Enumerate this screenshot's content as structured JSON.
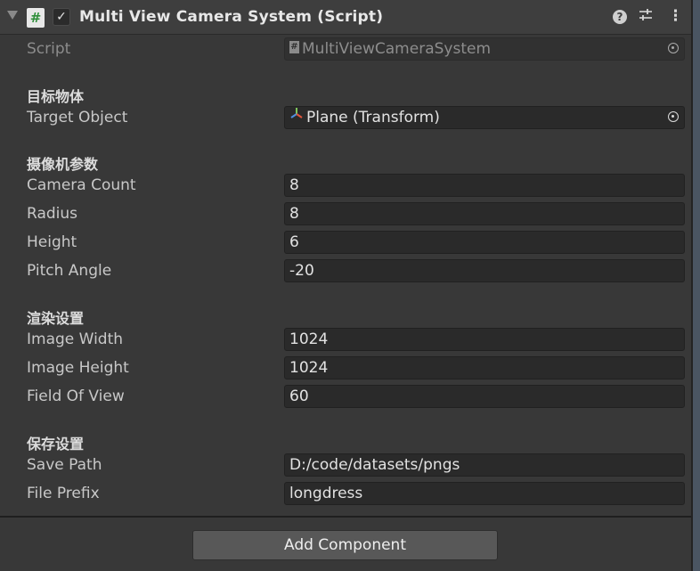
{
  "header": {
    "title": "Multi View Camera System (Script)",
    "enabled_check": "✓",
    "script_icon": "#",
    "icons": [
      "fold-arrow-icon",
      "script-hash-icon",
      "help-icon",
      "preset-sliders-icon",
      "kebab-menu-icon"
    ]
  },
  "script_row": {
    "label": "Script",
    "value": "MultiViewCameraSystem"
  },
  "sections": {
    "target": "目标物体",
    "camera": "摄像机参数",
    "render": "渲染设置",
    "save": "保存设置"
  },
  "fields": {
    "target_object": {
      "label": "Target Object",
      "value": "Plane (Transform)"
    },
    "camera_count": {
      "label": "Camera Count",
      "value": "8"
    },
    "radius": {
      "label": "Radius",
      "value": "8"
    },
    "height": {
      "label": "Height",
      "value": "6"
    },
    "pitch_angle": {
      "label": "Pitch Angle",
      "value": "-20"
    },
    "image_width": {
      "label": "Image Width",
      "value": "1024"
    },
    "image_height": {
      "label": "Image Height",
      "value": "1024"
    },
    "field_of_view": {
      "label": "Field Of View",
      "value": "60"
    },
    "save_path": {
      "label": "Save Path",
      "value": "D:/code/datasets/pngs"
    },
    "file_prefix": {
      "label": "File Prefix",
      "value": "longdress"
    }
  },
  "add_component_label": "Add Component",
  "colors": {
    "background": "#383838",
    "field_bg": "#2a2a2a",
    "button_bg": "#585858",
    "script_icon_green": "#2f8f3a"
  }
}
